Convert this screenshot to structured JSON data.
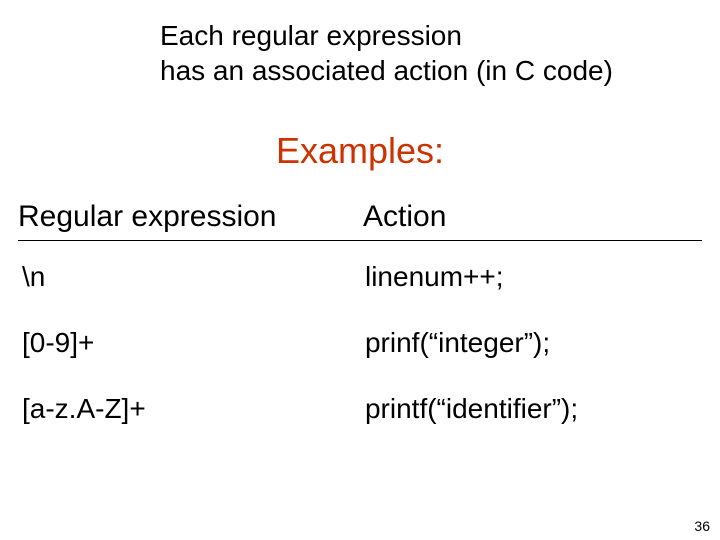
{
  "intro": {
    "line1": "Each regular expression",
    "line2": "has an associated action (in C code)"
  },
  "examples_title": "Examples:",
  "table": {
    "header_regex": "Regular expression",
    "header_action": "Action",
    "rows": [
      {
        "regex": "\\n",
        "action": "linenum++;"
      },
      {
        "regex": "[0-9]+",
        "action": "prinf(“integer”);"
      },
      {
        "regex": "[a-z.A-Z]+",
        "action": "printf(“identifier”);"
      }
    ]
  },
  "page_number": "36"
}
